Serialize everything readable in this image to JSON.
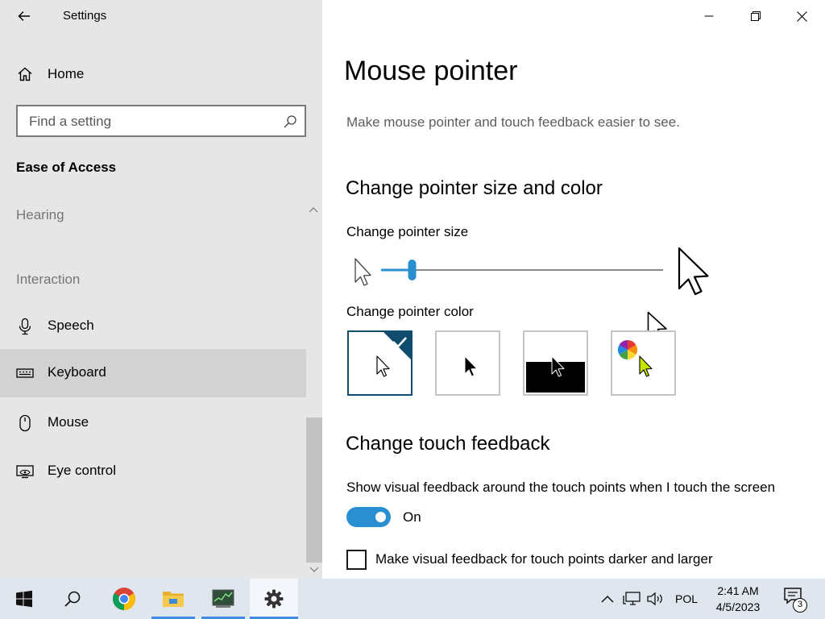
{
  "window": {
    "app_title": "Settings",
    "controls": [
      "minimize",
      "maximize",
      "close"
    ]
  },
  "sidebar": {
    "home_label": "Home",
    "search": {
      "placeholder": "Find a setting",
      "value": ""
    },
    "section_title": "Ease of Access",
    "groups": {
      "hearing": "Hearing",
      "interaction": "Interaction"
    },
    "items": [
      {
        "label": "Speech",
        "icon": "microphone-icon",
        "selected": false
      },
      {
        "label": "Keyboard",
        "icon": "keyboard-icon",
        "selected": true
      },
      {
        "label": "Mouse",
        "icon": "mouse-icon",
        "selected": false
      },
      {
        "label": "Eye control",
        "icon": "eye-control-icon",
        "selected": false
      }
    ]
  },
  "main": {
    "title": "Mouse pointer",
    "description": "Make mouse pointer and touch feedback easier to see.",
    "pointer_section": {
      "heading": "Change pointer size and color",
      "size_label": "Change pointer size",
      "size_value": 0.11,
      "color_label": "Change pointer color",
      "color_options": [
        {
          "name": "white",
          "selected": true
        },
        {
          "name": "black",
          "selected": false
        },
        {
          "name": "inverted",
          "selected": false
        },
        {
          "name": "custom",
          "selected": false
        }
      ]
    },
    "touch_section": {
      "heading": "Change touch feedback",
      "feedback_label": "Show visual feedback around the touch points when I touch the screen",
      "toggle_state": "On",
      "toggle_on": true,
      "darker_label": "Make visual feedback for touch points darker and larger",
      "darker_checked": false
    }
  },
  "taskbar": {
    "apps": [
      "start-icon",
      "search-icon",
      "chrome-icon",
      "file-explorer-icon",
      "task-manager-icon",
      "settings-icon"
    ],
    "language": "POL",
    "time": "2:41 AM",
    "date": "4/5/2023",
    "notification_count": "3"
  },
  "colors": {
    "accent": "#2a8fd0",
    "sidebar_bg": "#e6e6e6",
    "selected_item_bg": "#d2d2d2",
    "taskbar_bg": "#dfe6ee",
    "selected_tile_border": "#0f4c6d",
    "custom_pointer": "#c6e400"
  }
}
